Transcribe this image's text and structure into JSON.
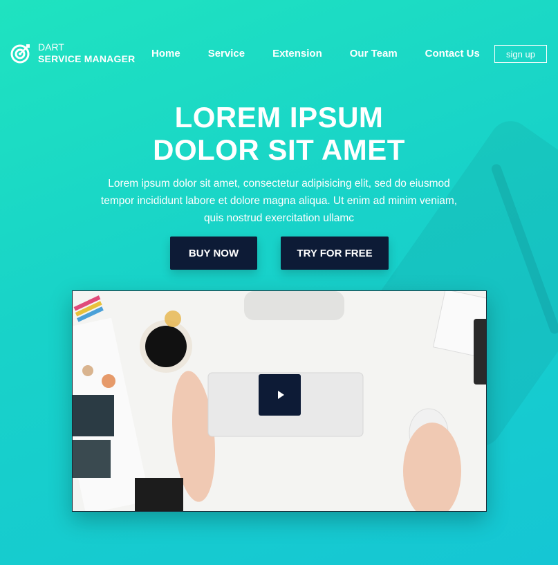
{
  "brand": {
    "line1": "DART",
    "line2": "SERVICE MANAGER",
    "icon": "target-icon"
  },
  "nav": {
    "items": [
      "Home",
      "Service",
      "Extension",
      "Our Team",
      "Contact Us"
    ],
    "signup_label": "sign up"
  },
  "hero": {
    "title_line1": "LOREM IPSUM",
    "title_line2": "DOLOR SIT AMET",
    "text": "Lorem ipsum dolor sit amet, consectetur adipisicing elit, sed do eiusmod tempor incididunt labore et dolore magna aliqua. Ut enim ad minim veniam, quis nostrud exercitation ullamc",
    "buy_label": "BUY NOW",
    "try_label": "TRY FOR FREE"
  },
  "video": {
    "play_icon": "play-icon"
  },
  "colors": {
    "gradient_start": "#1fe3c0",
    "gradient_end": "#15c6d4",
    "button_bg": "#0d1b36"
  }
}
